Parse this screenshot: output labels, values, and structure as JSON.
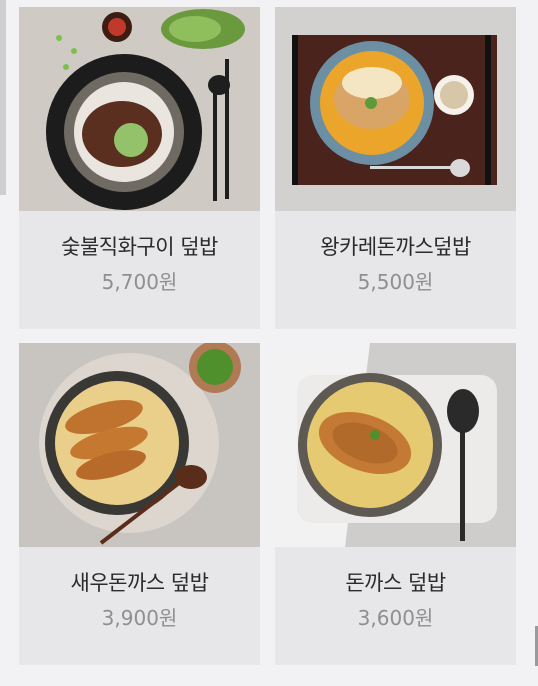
{
  "menu": {
    "items": [
      {
        "name": "숯불직화구이 덮밥",
        "price": "5,700원"
      },
      {
        "name": "왕카레돈까스덮밥",
        "price": "5,500원"
      },
      {
        "name": "새우돈까스 덮밥",
        "price": "3,900원"
      },
      {
        "name": "돈까스 덮밥",
        "price": "3,600원"
      }
    ]
  }
}
